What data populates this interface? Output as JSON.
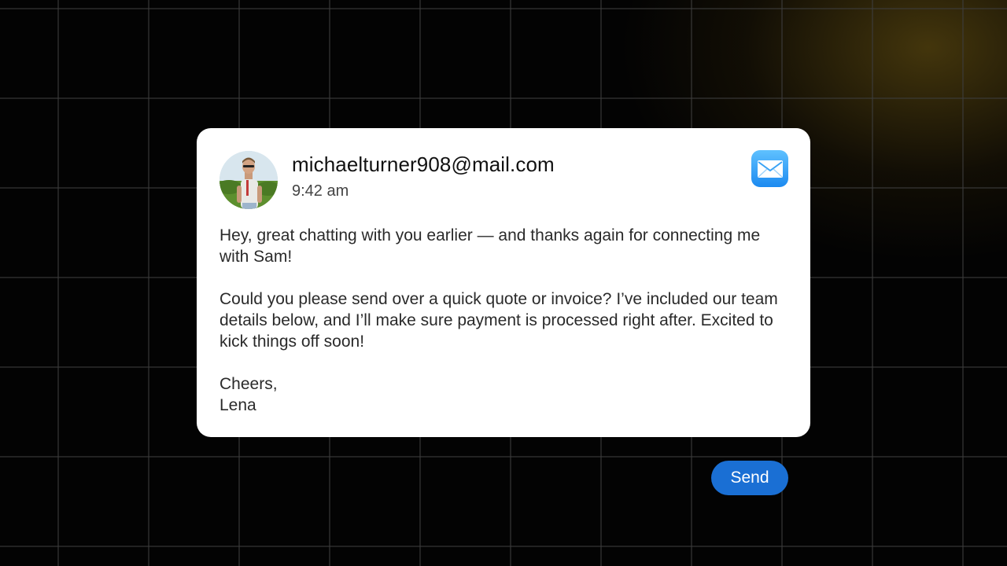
{
  "email": {
    "sender": "michaelturner908@mail.com",
    "time": "9:42 am",
    "app_icon": "mail-icon",
    "body": {
      "paragraph_1": "Hey, great chatting with you earlier — and thanks again for connecting me with Sam!",
      "paragraph_2": "Could you please send over a quick quote or invoice? I’ve included our team details below, and I’ll make sure payment is processed right after. Excited to kick things off soon!",
      "signoff": "Cheers,",
      "signature": "Lena"
    }
  },
  "actions": {
    "send_label": "Send"
  },
  "colors": {
    "accent": "#1a6fd4",
    "card_background": "#ffffff",
    "page_background": "#030303",
    "mail_icon_top": "#5fc1ff",
    "mail_icon_bottom": "#1c8af0"
  }
}
